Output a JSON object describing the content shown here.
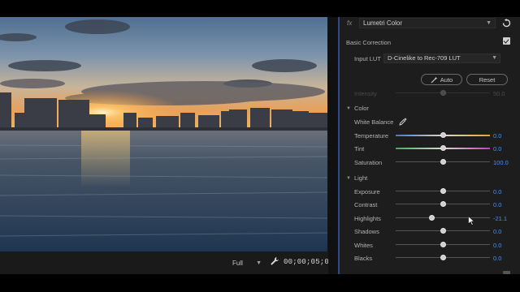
{
  "monitor": {
    "quality_label": "Full",
    "timecode": "00;00;05;00"
  },
  "lumetri": {
    "fx_label": "fx",
    "effect_name": "Lumetri Color",
    "basic_correction": {
      "title": "Basic Correction",
      "enabled": true,
      "input_lut_label": "Input LUT",
      "input_lut_value": "D-Cinelike to Rec-709 LUT",
      "auto_label": "Auto",
      "reset_label": "Reset",
      "intensity_label": "Intensity",
      "intensity_value": "50.0",
      "intensity_fraction": 0.5
    },
    "color": {
      "title": "Color",
      "white_balance_label": "White Balance",
      "temperature_label": "Temperature",
      "temperature_value": "0.0",
      "temperature_fraction": 0.5,
      "tint_label": "Tint",
      "tint_value": "0.0",
      "tint_fraction": 0.5,
      "saturation_label": "Saturation",
      "saturation_value": "100.0",
      "saturation_fraction": 0.5
    },
    "light": {
      "title": "Light",
      "exposure_label": "Exposure",
      "exposure_value": "0.0",
      "exposure_fraction": 0.5,
      "contrast_label": "Contrast",
      "contrast_value": "0.0",
      "contrast_fraction": 0.5,
      "highlights_label": "Highlights",
      "highlights_value": "-21.1",
      "highlights_fraction": 0.38,
      "shadows_label": "Shadows",
      "shadows_value": "0.0",
      "shadows_fraction": 0.5,
      "whites_label": "Whites",
      "whites_value": "0.0",
      "whites_fraction": 0.5,
      "blacks_label": "Blacks",
      "blacks_value": "0.0",
      "blacks_fraction": 0.5
    }
  },
  "icons": {
    "quality_dropdown": "chevron-down-icon",
    "settings": "wrench-icon",
    "reset_effect": "reset-icon",
    "auto": "magic-wand-icon",
    "white_balance": "eyedropper-icon",
    "section_toggle": "chevron-down-icon",
    "pointer": "mouse-cursor-icon"
  },
  "colors": {
    "value_accent": "#4d8fe6",
    "panel_bg": "#1d1d1d",
    "temperature_cool": "#3a7bd5",
    "temperature_warm": "#e8a23a",
    "tint_green": "#3fb44a",
    "tint_magenta": "#c93fbf"
  }
}
